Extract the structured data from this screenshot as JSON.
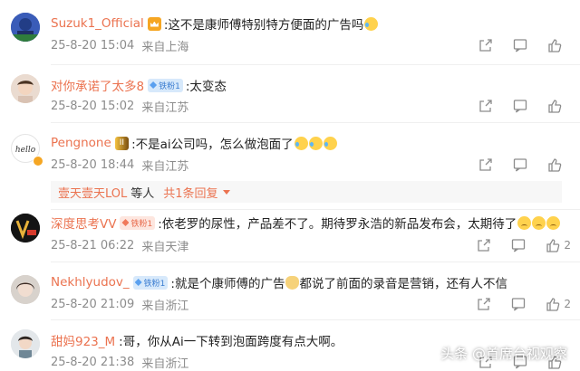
{
  "colors": {
    "username": "#eb7350",
    "meta": "#8c8c8c",
    "text": "#222222",
    "fan_badge_bg": "#d7e9fb",
    "replies_bg": "#f7f7f7"
  },
  "comments": [
    {
      "username": "Suzuk1_Official",
      "text": ":这不是康师傅特别特方便面的广告吗",
      "time": "25-8-20 15:04",
      "location": "来自上海",
      "likes": ""
    },
    {
      "username": "对你承诺了太多8",
      "badge": "铁粉1",
      "text": ":太变态",
      "time": "25-8-20 15:02",
      "location": "来自江苏",
      "likes": ""
    },
    {
      "username": "Pengnone",
      "text": ":不是ai公司吗，怎么做泡面了",
      "time": "25-8-20 18:44",
      "location": "来自江苏",
      "likes": "",
      "replies": {
        "name": "壹天壹天LOL",
        "suffix": "等人",
        "count": "共1条回复"
      }
    },
    {
      "username": "深度思考VV",
      "badge": "铁粉1",
      "text": ":依老罗的尿性，产品差不了。期待罗永浩的新品发布会，太期待了",
      "time": "25-8-21 06:22",
      "location": "来自天津",
      "likes": "2"
    },
    {
      "username": "Nekhlyudov_",
      "badge": "铁粉1",
      "text": ":就是个康师傅的广告",
      "text2": "都说了前面的录音是营销，还有人不信",
      "time": "25-8-20 21:09",
      "location": "来自浙江",
      "likes": "2"
    },
    {
      "username": "甜妈923_M",
      "text": ":哥，你从Ai一下转到泡面跨度有点大啊。",
      "time": "25-8-20 21:38",
      "location": "来自浙江",
      "likes": ""
    }
  ],
  "watermark": "头条 @首席台视观察",
  "icons": [
    "share-icon",
    "comment-icon",
    "like-icon"
  ]
}
